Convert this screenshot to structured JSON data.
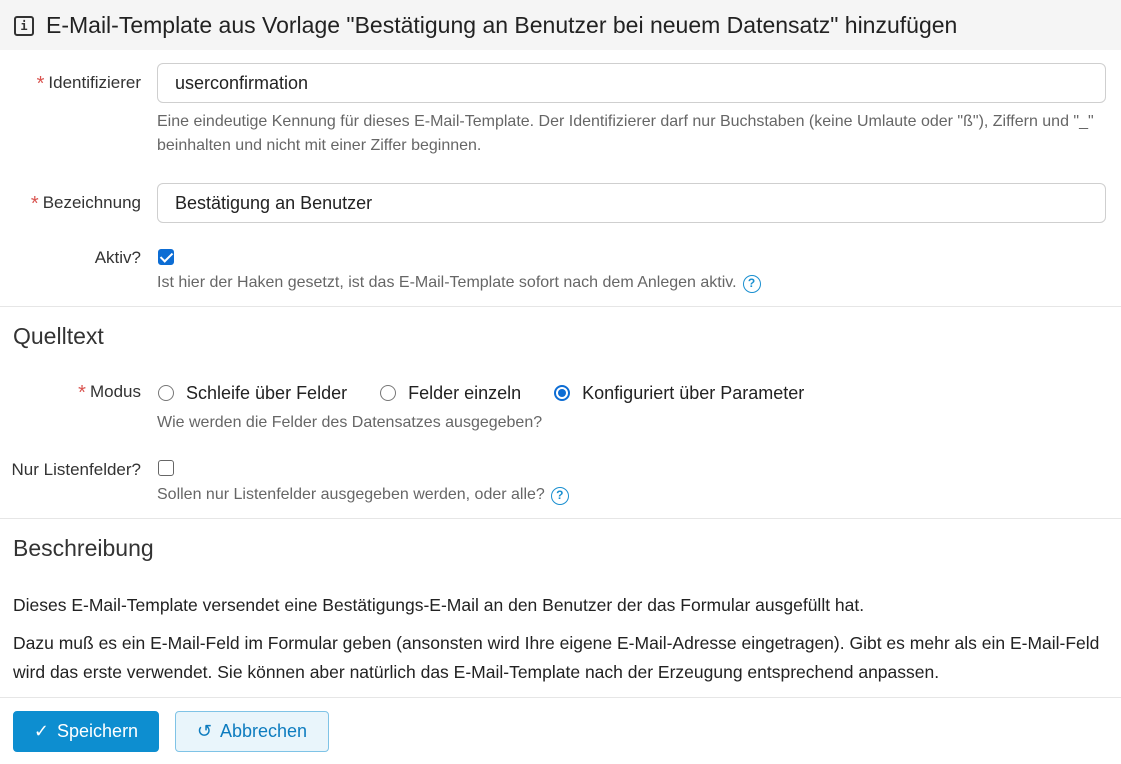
{
  "header": {
    "icon": "info-icon",
    "title": "E-Mail-Template aus Vorlage \"Bestätigung an Benutzer bei neuem Datensatz\" hinzufügen"
  },
  "fields": {
    "identifier": {
      "label": "Identifizierer",
      "required_marker": "*",
      "value": "userconfirmation",
      "help": "Eine eindeutige Kennung für dieses E-Mail-Template. Der Identifizierer darf nur Buchstaben (keine Umlaute oder \"ß\"), Ziffern und \"_\" beinhalten und nicht mit einer Ziffer beginnen."
    },
    "name": {
      "label": "Bezeichnung",
      "required_marker": "*",
      "value": "Bestätigung an Benutzer"
    },
    "active": {
      "label": "Aktiv?",
      "checked": true,
      "help": "Ist hier der Haken gesetzt, ist das E-Mail-Template sofort nach dem Anlegen aktiv.",
      "help_icon": "question-circle-icon"
    }
  },
  "source": {
    "title": "Quelltext",
    "mode": {
      "label": "Modus",
      "required_marker": "*",
      "options": [
        {
          "label": "Schleife über Felder",
          "checked": false
        },
        {
          "label": "Felder einzeln",
          "checked": false
        },
        {
          "label": "Konfiguriert über Parameter",
          "checked": true
        }
      ],
      "help": "Wie werden die Felder des Datensatzes ausgegeben?"
    },
    "list_only": {
      "label": "Nur Listenfelder?",
      "checked": false,
      "help": "Sollen nur Listenfelder ausgegeben werden, oder alle?",
      "help_icon": "question-circle-icon"
    }
  },
  "description": {
    "title": "Beschreibung",
    "p1": "Dieses E-Mail-Template versendet eine Bestätigungs-E-Mail an den Benutzer der das Formular ausgefüllt hat.",
    "p2": "Dazu muß es ein E-Mail-Feld im Formular geben (ansonsten wird Ihre eigene E-Mail-Adresse eingetragen). Gibt es mehr als ein E-Mail-Feld wird das erste verwendet. Sie können aber natürlich das E-Mail-Template nach der Erzeugung entsprechend anpassen."
  },
  "buttons": {
    "save": {
      "label": "Speichern",
      "icon": "check-icon"
    },
    "cancel": {
      "label": "Abbrechen",
      "icon": "undo-icon"
    }
  },
  "colors": {
    "primary": "#0d8ed0",
    "required": "#d9534f",
    "checkbox": "#0d6dd4"
  }
}
